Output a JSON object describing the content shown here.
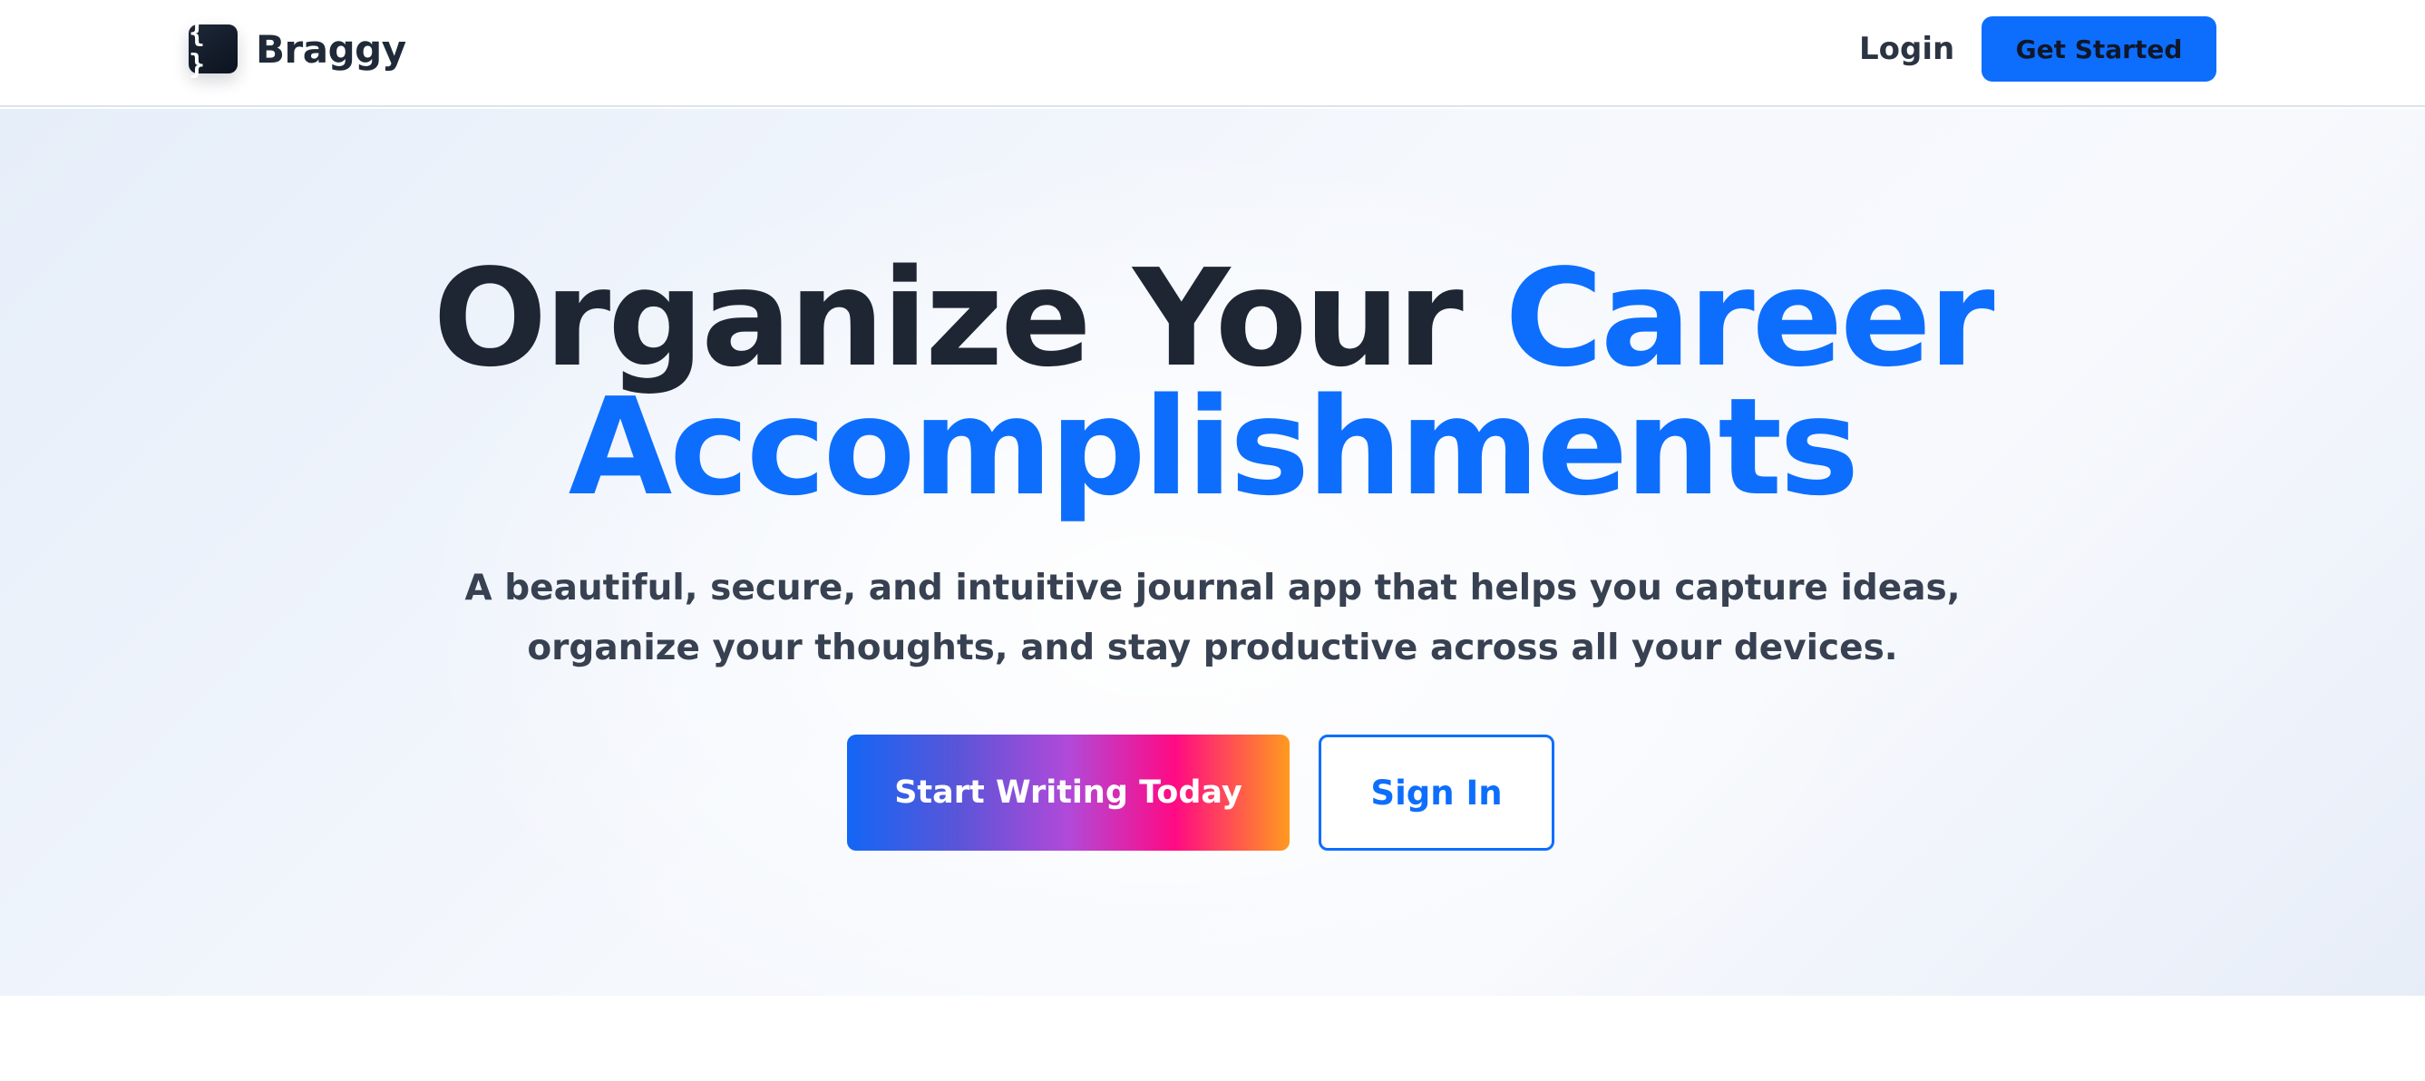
{
  "header": {
    "logo_glyph": "{ }",
    "brand_name": "Braggy",
    "login_label": "Login",
    "get_started_label": "Get Started"
  },
  "hero": {
    "title_part1": "Organize Your ",
    "title_accent_line1": "Career",
    "title_accent_line2": "Accomplishments",
    "subtitle": "A beautiful, secure, and intuitive journal app that helps you capture ideas, organize your thoughts, and stay productive across all your devices.",
    "primary_cta_label": "Start Writing Today",
    "secondary_cta_label": "Sign In"
  },
  "colors": {
    "accent": "#0d6efd",
    "heading": "#1e2633",
    "body_text": "#374151",
    "cta_gradient": [
      "#1366f5",
      "#5a55d8",
      "#b149d9",
      "#ff0a84",
      "#ff9a1f"
    ]
  },
  "icons": {
    "logo": "curly-braces-icon"
  }
}
